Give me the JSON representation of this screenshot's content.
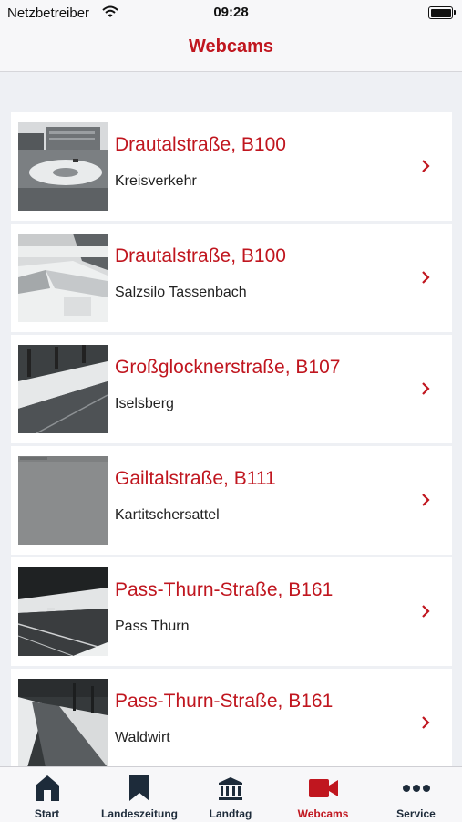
{
  "status": {
    "carrier": "Netzbetreiber",
    "time": "09:28"
  },
  "nav": {
    "title": "Webcams"
  },
  "webcams": [
    {
      "title": "Drautalstraße, B100",
      "subtitle": "Kreisverkehr"
    },
    {
      "title": "Drautalstraße, B100",
      "subtitle": "Salzsilo Tassenbach"
    },
    {
      "title": "Großglocknerstraße, B107",
      "subtitle": "Iselsberg"
    },
    {
      "title": "Gailtalstraße, B111",
      "subtitle": "Kartitschersattel"
    },
    {
      "title": "Pass-Thurn-Straße, B161",
      "subtitle": "Pass Thurn"
    },
    {
      "title": "Pass-Thurn-Straße, B161",
      "subtitle": "Waldwirt"
    }
  ],
  "tabs": [
    {
      "label": "Start",
      "icon": "house-icon"
    },
    {
      "label": "Landeszeitung",
      "icon": "bookmark-icon"
    },
    {
      "label": "Landtag",
      "icon": "building-icon"
    },
    {
      "label": "Webcams",
      "icon": "video-camera-icon",
      "active": true
    },
    {
      "label": "Service",
      "icon": "more-dots-icon"
    }
  ],
  "colors": {
    "accent": "#c0161f",
    "tab_icon": "#1d2b3a",
    "background": "#eef0f4"
  }
}
